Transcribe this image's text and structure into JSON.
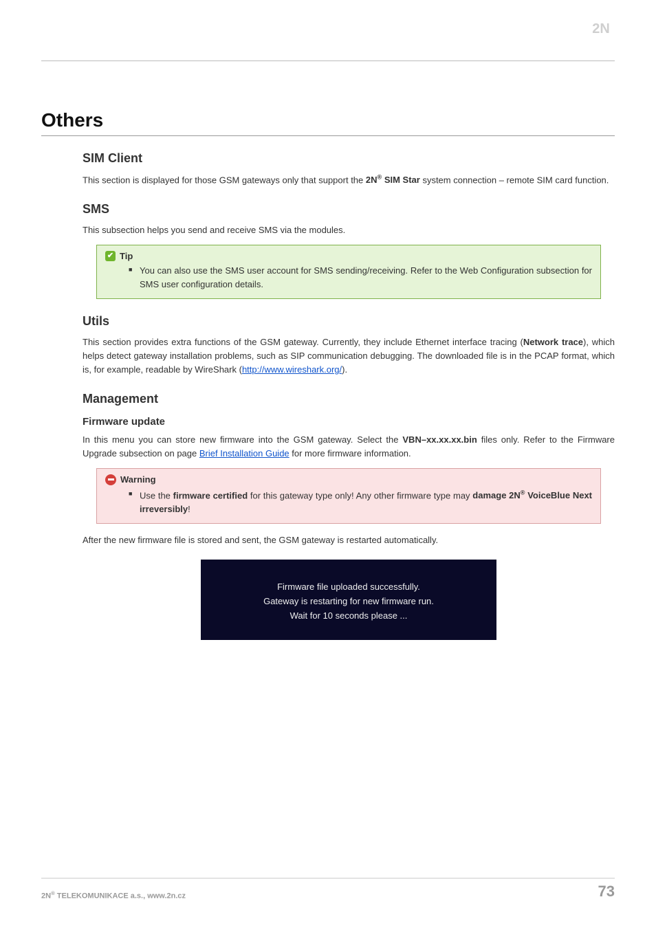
{
  "logo_alt": "2N",
  "h1": "Others",
  "sections": {
    "sim": {
      "heading": "SIM Client",
      "para_pre": "This section is displayed for those GSM gateways only that support the ",
      "brand_pre": "2N",
      "brand_sup": "®",
      "brand_post": " SIM Star",
      "para_post": " system connection – remote SIM card function."
    },
    "sms": {
      "heading": "SMS",
      "para": "This subsection helps you send and receive SMS via the modules.",
      "tip_label": "Tip",
      "tip_text": "You can also use the SMS user account for SMS sending/receiving. Refer to the Web Configuration subsection for SMS user configuration details."
    },
    "utils": {
      "heading": "Utils",
      "para_a": "This section provides extra functions of the GSM gateway. Currently, they include Ethernet interface tracing (",
      "bold": "Network trace",
      "para_b": "), which helps detect gateway installation problems, such as SIP communication debugging. The downloaded file is in the PCAP format, which is, for example, readable by WireShark (",
      "link": "http://www.wireshark.org/",
      "para_c": ")."
    },
    "mgmt": {
      "heading": "Management",
      "fw_heading": "Firmware update",
      "fw_a": "In this menu you can store new firmware into the GSM gateway. Select the ",
      "fw_bold": "VBN–xx.xx.xx.bin",
      "fw_b": " files only. Refer to the Firmware Upgrade subsection on page ",
      "fw_link": "Brief Installation Guide",
      "fw_c": " for more firmware information.",
      "warn_label": "Warning",
      "warn_a": "Use the ",
      "warn_bold1": "firmware certified",
      "warn_b": " for this gateway type only! Any other firmware type may ",
      "warn_bold2": "damage 2N",
      "warn_sup": "®",
      "warn_bold3": " VoiceBlue Next irreversibly",
      "warn_c": "!",
      "after": "After the new firmware file is stored and sent, the GSM gateway is restarted automatically.",
      "status1": "Firmware file uploaded successfully.",
      "status2": "Gateway is restarting for new firmware run.",
      "status3": "Wait for 10 seconds please ..."
    }
  },
  "footer": {
    "left_a": "2N",
    "left_sup": "®",
    "left_b": " TELEKOMUNIKACE a.s., www.2n.cz",
    "page": "73"
  }
}
